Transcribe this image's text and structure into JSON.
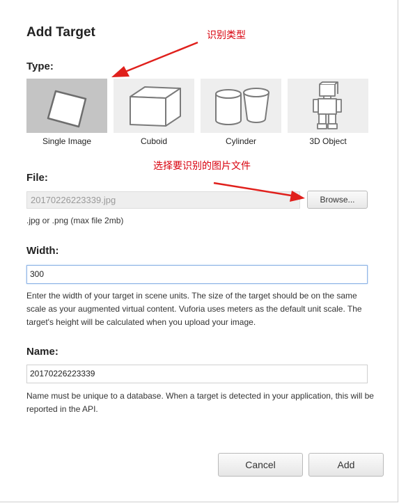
{
  "dialog": {
    "title": "Add Target"
  },
  "annotations": {
    "type_note": "识别类型",
    "file_note": "选择要识别的图片文件",
    "color": "#d8000c"
  },
  "type_section": {
    "label": "Type:",
    "options": [
      {
        "label": "Single Image",
        "icon": "single-image-icon",
        "selected": true
      },
      {
        "label": "Cuboid",
        "icon": "cuboid-icon",
        "selected": false
      },
      {
        "label": "Cylinder",
        "icon": "cylinder-icon",
        "selected": false
      },
      {
        "label": "3D Object",
        "icon": "3d-object-icon",
        "selected": false
      }
    ]
  },
  "file_section": {
    "label": "File:",
    "value": "20170226223339.jpg",
    "browse_label": "Browse...",
    "hint": ".jpg or .png (max file 2mb)"
  },
  "width_section": {
    "label": "Width:",
    "value": "300",
    "hint": "Enter the width of your target in scene units. The size of the target should be on the same scale as your augmented virtual content. Vuforia uses meters as the default unit scale. The target's height will be calculated when you upload your image."
  },
  "name_section": {
    "label": "Name:",
    "value": "20170226223339",
    "hint": "Name must be unique to a database. When a target is detected in your application, this will be reported in the API."
  },
  "footer": {
    "cancel_label": "Cancel",
    "add_label": "Add"
  }
}
